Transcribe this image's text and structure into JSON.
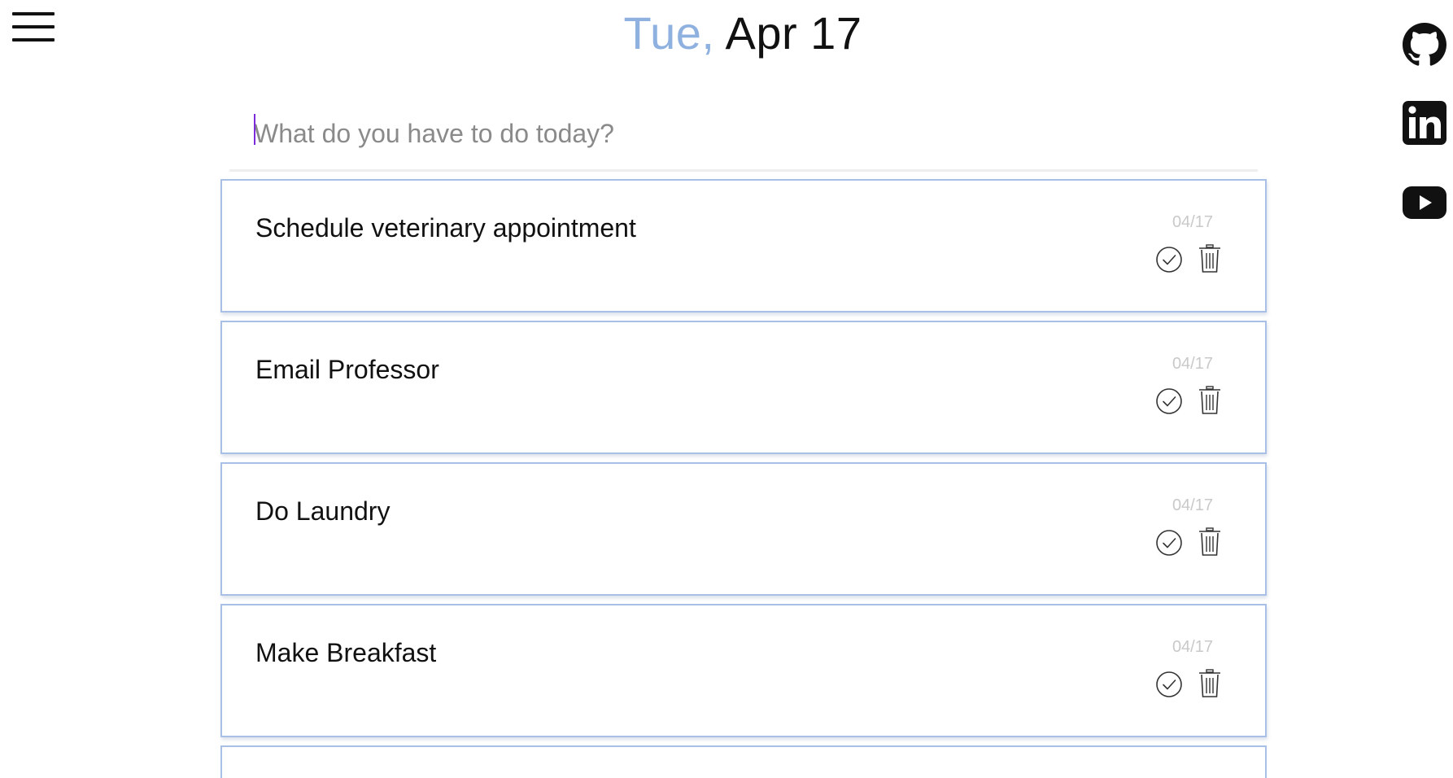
{
  "header": {
    "weekday": "Tue,",
    "date": "Apr 17"
  },
  "new_task": {
    "placeholder": "What do you have to do today?",
    "value": ""
  },
  "tasks": [
    {
      "title": "Schedule veterinary appointment",
      "date": "04/17"
    },
    {
      "title": "Email Professor",
      "date": "04/17"
    },
    {
      "title": "Do Laundry",
      "date": "04/17"
    },
    {
      "title": "Make Breakfast",
      "date": "04/17"
    },
    {
      "title": "",
      "date": ""
    }
  ],
  "icons": {
    "menu": "hamburger-menu-icon",
    "complete": "check-circle-icon",
    "delete": "trash-icon",
    "social": [
      "github-icon",
      "linkedin-icon",
      "youtube-icon"
    ]
  },
  "colors": {
    "accent": "#8fb1df",
    "card_border": "#a9c0e6",
    "date_text": "#c9c9c9",
    "caret": "#7b2bd8"
  }
}
